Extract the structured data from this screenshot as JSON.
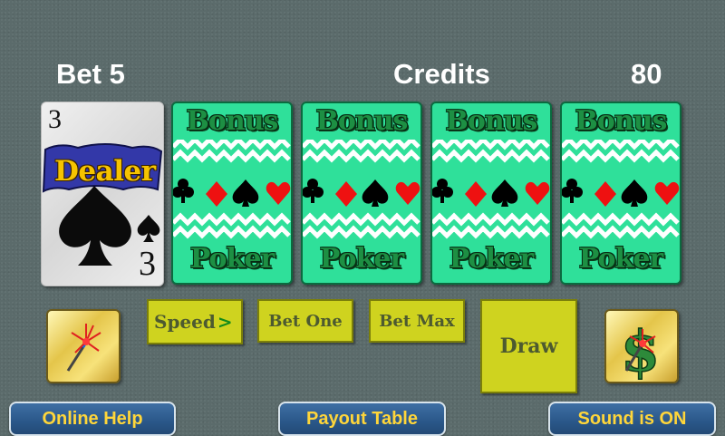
{
  "hud": {
    "bet": "Bet  5",
    "credits_label": "Credits",
    "credits_value": "80"
  },
  "dealer_card": {
    "rank": "3",
    "suit": "spades",
    "label": "Dealer",
    "suit_icon": "spade-icon"
  },
  "card_back": {
    "top_word": "Bonus",
    "bottom_word": "Poker",
    "count": 4
  },
  "controls": {
    "speed": "Speed",
    "speed_arrow": ">",
    "bet_one": "Bet One",
    "bet_max": "Bet Max",
    "draw": "Draw"
  },
  "tiles": {
    "left_icon": "magic-wand-icon",
    "right_icon": "dollar-money-icon"
  },
  "nav": {
    "online_help": "Online Help",
    "payout_table": "Payout Table",
    "sound": "Sound is ON"
  },
  "colors": {
    "felt": "#5b6b6b",
    "card_back_green": "#2fe09a",
    "button_yellow": "#cfd31f",
    "pill_blue": "#2a5789",
    "pill_text": "#ffd63a"
  }
}
